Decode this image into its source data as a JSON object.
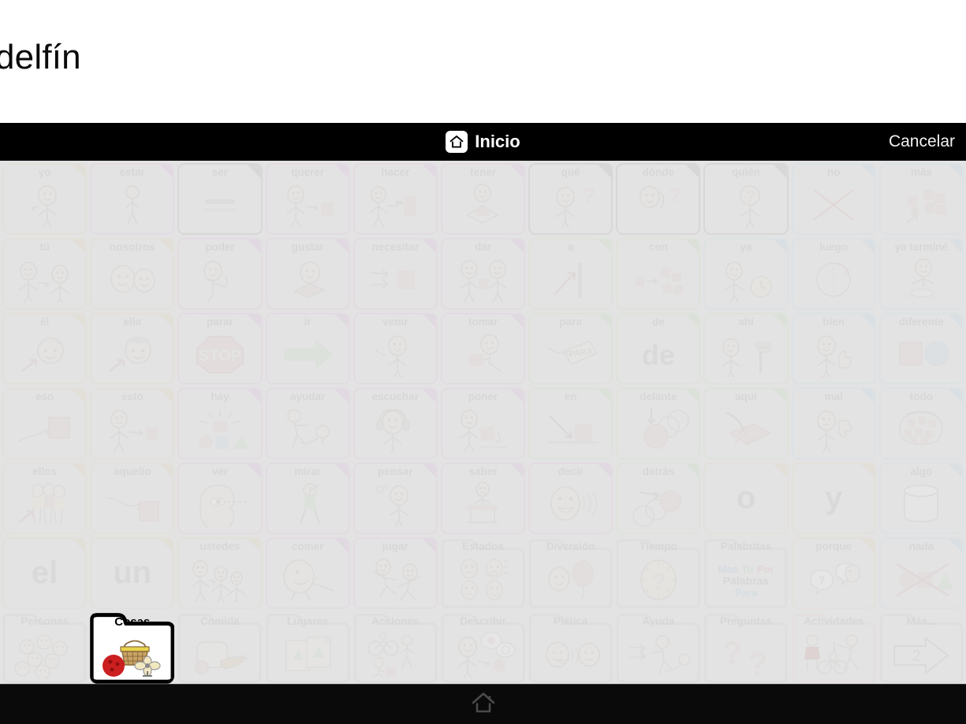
{
  "message_window": {
    "spoken_word": "delfín"
  },
  "header": {
    "title": "Inicio",
    "home_icon": "home-icon",
    "cancel_label": "Cancelar"
  },
  "footer": {
    "home_icon": "home-outline-icon"
  },
  "colors": {
    "pronoun_border": "#e8cfa8",
    "verb_border": "#ddaede",
    "question_border": "#8e8e8e",
    "preposition_border": "#b6e0ab",
    "describe_border": "#b3d4ec",
    "activity_border": "#eec4c4",
    "folder_border": "#c9c9c9",
    "selected_border": "#000000",
    "board_background": "#e3e3e3",
    "cell_background": "#e8e8e8",
    "header_background": "#000000",
    "label_text": "#8b8b8b"
  },
  "grid": {
    "columns": 11,
    "rows": 7
  },
  "cells": [
    {
      "label": "yo",
      "cat": "tan",
      "icon": "person-pointing-self-icon"
    },
    {
      "label": "estar",
      "cat": "purple",
      "icon": "standing-person-icon"
    },
    {
      "label": "ser",
      "cat": "gray",
      "icon": "two-bars-icon"
    },
    {
      "label": "querer",
      "cat": "purple",
      "icon": "reaching-for-object-icon"
    },
    {
      "label": "hacer",
      "cat": "purple",
      "icon": "hammering-icon"
    },
    {
      "label": "tener",
      "cat": "purple",
      "icon": "holding-object-icon"
    },
    {
      "label": "qué",
      "cat": "gray",
      "icon": "person-shrug-question-icon"
    },
    {
      "label": "dónde",
      "cat": "gray",
      "icon": "looking-around-question-icon"
    },
    {
      "label": "quién",
      "cat": "gray",
      "icon": "person-question-face-icon"
    },
    {
      "label": "no",
      "cat": "blue",
      "icon": "red-x-cross-icon"
    },
    {
      "label": "más",
      "cat": "blue",
      "icon": "more-blocks-arrow-icon"
    },
    {
      "label": "tú",
      "cat": "tan",
      "icon": "two-people-pointing-icon"
    },
    {
      "label": "nosotros",
      "cat": "tan",
      "icon": "two-faces-icon"
    },
    {
      "label": "poder",
      "cat": "purple",
      "icon": "flexing-arm-icon"
    },
    {
      "label": "gustar",
      "cat": "purple",
      "icon": "happy-face-gift-icon"
    },
    {
      "label": "necesitar",
      "cat": "purple",
      "icon": "hands-reaching-square-icon"
    },
    {
      "label": "dar",
      "cat": "purple",
      "icon": "giving-object-icon"
    },
    {
      "label": "a",
      "cat": "green",
      "icon": "arrow-to-line-icon"
    },
    {
      "label": "con",
      "cat": "green",
      "icon": "blocks-together-icon"
    },
    {
      "label": "ya",
      "cat": "blue",
      "icon": "person-clock-icon"
    },
    {
      "label": "luego",
      "cat": "blue",
      "icon": "clock-half-icon"
    },
    {
      "label": "ya terminé",
      "cat": "blue",
      "icon": "hands-up-finished-icon"
    },
    {
      "label": "él",
      "cat": "tan",
      "icon": "boy-face-arrow-icon"
    },
    {
      "label": "ella",
      "cat": "tan",
      "icon": "girl-face-arrow-icon"
    },
    {
      "label": "parar",
      "cat": "purple",
      "icon": "stop-sign-icon",
      "icon_text": "STOP"
    },
    {
      "label": "ir",
      "cat": "purple",
      "icon": "green-arrow-right-icon"
    },
    {
      "label": "venir",
      "cat": "purple",
      "icon": "beckoning-person-icon"
    },
    {
      "label": "tomar",
      "cat": "purple",
      "icon": "taking-object-icon"
    },
    {
      "label": "para",
      "cat": "green",
      "icon": "tag-label-icon",
      "icon_text": "PARA"
    },
    {
      "label": "de",
      "cat": "green",
      "text_only": true,
      "big_text": "de"
    },
    {
      "label": "ahí",
      "cat": "green",
      "icon": "pointing-at-signpost-icon"
    },
    {
      "label": "bien",
      "cat": "blue",
      "icon": "thumbs-up-icon"
    },
    {
      "label": "diferente",
      "cat": "blue",
      "icon": "square-and-circle-icon"
    },
    {
      "label": "eso",
      "cat": "tan",
      "icon": "hand-pointing-square-icon"
    },
    {
      "label": "esto",
      "cat": "tan",
      "icon": "person-pointing-square-icon"
    },
    {
      "label": "hay",
      "cat": "purple",
      "icon": "shapes-presentation-icon"
    },
    {
      "label": "ayudar",
      "cat": "purple",
      "icon": "helping-person-up-icon"
    },
    {
      "label": "escuchar",
      "cat": "purple",
      "icon": "headphones-listening-icon"
    },
    {
      "label": "poner",
      "cat": "purple",
      "icon": "placing-object-down-icon"
    },
    {
      "label": "en",
      "cat": "green",
      "icon": "arrow-onto-surface-icon"
    },
    {
      "label": "delante",
      "cat": "green",
      "icon": "circle-in-front-icon"
    },
    {
      "label": "aquí",
      "cat": "green",
      "icon": "pointing-at-ground-icon"
    },
    {
      "label": "mal",
      "cat": "blue",
      "icon": "thumbs-down-icon"
    },
    {
      "label": "todo",
      "cat": "blue",
      "icon": "all-blocks-circled-icon"
    },
    {
      "label": "ellos",
      "cat": "tan",
      "icon": "group-of-people-arrow-icon"
    },
    {
      "label": "aquello",
      "cat": "tan",
      "icon": "hand-pointing-far-square-icon"
    },
    {
      "label": "ver",
      "cat": "purple",
      "icon": "eye-looking-icon"
    },
    {
      "label": "mirar",
      "cat": "purple",
      "icon": "person-watching-icon"
    },
    {
      "label": "pensar",
      "cat": "purple",
      "icon": "thinking-person-icon"
    },
    {
      "label": "saber",
      "cat": "purple",
      "icon": "person-at-desk-icon"
    },
    {
      "label": "decir",
      "cat": "purple",
      "icon": "talking-face-icon"
    },
    {
      "label": "detrás",
      "cat": "green",
      "icon": "circle-behind-icon"
    },
    {
      "label": "o",
      "cat": "tan",
      "text_only": true,
      "big_text": "o"
    },
    {
      "label": "y",
      "cat": "tan",
      "text_only": true,
      "big_text": "y"
    },
    {
      "label": "algo",
      "cat": "blue",
      "icon": "cylinder-container-icon"
    },
    {
      "label": "el",
      "cat": "tan",
      "text_only": true,
      "big_text": "el"
    },
    {
      "label": "un",
      "cat": "tan",
      "text_only": true,
      "big_text": "un"
    },
    {
      "label": "ustedes",
      "cat": "tan",
      "icon": "pointing-at-group-icon"
    },
    {
      "label": "comer",
      "cat": "purple",
      "icon": "eating-with-fork-icon"
    },
    {
      "label": "jugar",
      "cat": "purple",
      "icon": "playing-children-icon"
    },
    {
      "label": "Estados",
      "cat": "folder",
      "icon": "four-emotion-faces-icon",
      "folder": true
    },
    {
      "label": "Diversión",
      "cat": "folder",
      "icon": "balloon-fun-icon",
      "folder": true
    },
    {
      "label": "Tiempo",
      "cat": "folder",
      "icon": "clock-question-icon",
      "folder": true
    },
    {
      "label": "Palabritas",
      "cat": "folder",
      "icon": "little-words-text-icon",
      "folder": true,
      "word_tiles": [
        "Mas",
        "Tu",
        "Por",
        "Palabras",
        "Para"
      ]
    },
    {
      "label": "porque",
      "cat": "tan",
      "icon": "speech-bubbles-question-icon"
    },
    {
      "label": "nada",
      "cat": "blue",
      "icon": "crossed-out-shapes-icon"
    },
    {
      "label": "Personas",
      "cat": "folder",
      "icon": "many-faces-icon",
      "folder": true
    },
    {
      "label": "Cosas",
      "cat": "folder",
      "icon": "basket-ball-fan-icon",
      "folder": true,
      "selected": true
    },
    {
      "label": "Comida",
      "cat": "folder",
      "icon": "bread-carrot-apple-icon",
      "folder": true
    },
    {
      "label": "Lugares",
      "cat": "folder",
      "icon": "two-maps-icon",
      "folder": true
    },
    {
      "label": "Acciones",
      "cat": "folder",
      "icon": "bicycle-walking-icon",
      "folder": true
    },
    {
      "label": "Describir",
      "cat": "folder",
      "icon": "describing-apple-icon",
      "folder": true
    },
    {
      "label": "Plática",
      "cat": "folder",
      "icon": "two-faces-talking-icon",
      "folder": true
    },
    {
      "label": "Ayuda",
      "cat": "folder",
      "icon": "helping-hands-icon",
      "folder": true
    },
    {
      "label": "Preguntas",
      "cat": "folder",
      "icon": "two-question-marks-icon",
      "folder": true
    },
    {
      "label": "Actividades",
      "cat": "folder_pink",
      "icon": "activities-sports-icon",
      "folder": true
    },
    {
      "label": "Más...",
      "cat": "folder",
      "icon": "next-page-arrow-icon",
      "folder": true,
      "page_number": "2"
    }
  ]
}
